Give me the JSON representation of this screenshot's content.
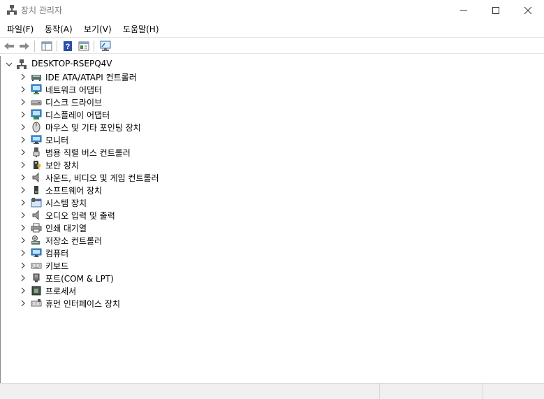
{
  "window": {
    "title": "장치 관리자",
    "icon": "device-manager-icon"
  },
  "menubar": {
    "items": [
      "파일(F)",
      "동작(A)",
      "보기(V)",
      "도움말(H)"
    ]
  },
  "toolbar": {
    "buttons": [
      "back-icon",
      "forward-icon",
      "show-hide-console-tree-icon",
      "help-icon",
      "properties-icon",
      "scan-hardware-icon"
    ]
  },
  "tree": {
    "root": "DESKTOP-RSEPQ4V",
    "categories": [
      {
        "label": "IDE ATA/ATAPI 컨트롤러",
        "icon": "ide-controller-icon"
      },
      {
        "label": "네트워크 어댑터",
        "icon": "network-adapter-icon"
      },
      {
        "label": "디스크 드라이브",
        "icon": "disk-drive-icon"
      },
      {
        "label": "디스플레이 어댑터",
        "icon": "display-adapter-icon"
      },
      {
        "label": "마우스 및 기타 포인팅 장치",
        "icon": "mouse-icon"
      },
      {
        "label": "모니터",
        "icon": "monitor-icon"
      },
      {
        "label": "범용 직렬 버스 컨트롤러",
        "icon": "usb-icon"
      },
      {
        "label": "보안 장치",
        "icon": "security-device-icon"
      },
      {
        "label": "사운드, 비디오 및 게임 컨트롤러",
        "icon": "speaker-icon"
      },
      {
        "label": "소프트웨어 장치",
        "icon": "software-device-icon"
      },
      {
        "label": "시스템 장치",
        "icon": "system-device-icon"
      },
      {
        "label": "오디오 입력 및 출력",
        "icon": "audio-io-icon"
      },
      {
        "label": "인쇄 대기열",
        "icon": "printer-icon"
      },
      {
        "label": "저장소 컨트롤러",
        "icon": "storage-controller-icon"
      },
      {
        "label": "컴퓨터",
        "icon": "computer-icon"
      },
      {
        "label": "키보드",
        "icon": "keyboard-icon"
      },
      {
        "label": "포트(COM & LPT)",
        "icon": "port-icon"
      },
      {
        "label": "프로세서",
        "icon": "processor-icon"
      },
      {
        "label": "휴먼 인터페이스 장치",
        "icon": "hid-icon"
      }
    ]
  }
}
